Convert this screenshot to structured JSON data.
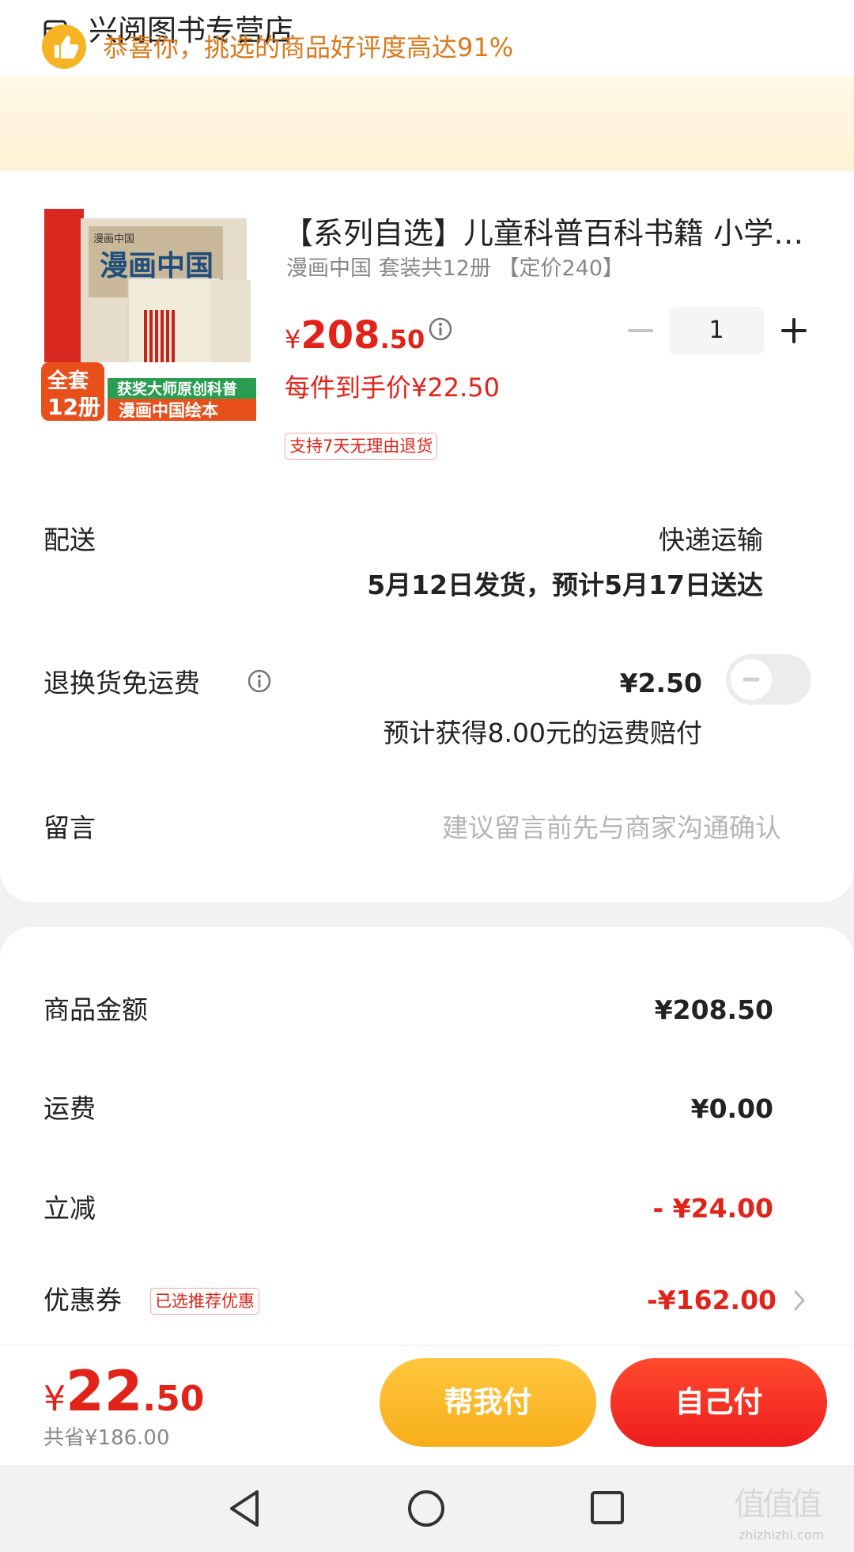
{
  "store": {
    "name": "兴阅图书专营店",
    "icon": "store-icon"
  },
  "banner": {
    "icon": "thumbs-up-icon",
    "text": "恭喜你，挑选的商品好评度高达91%",
    "color": "#d9791b"
  },
  "product": {
    "thumbnail": {
      "brand_top": "漫画中国",
      "big_title": "漫画中国",
      "set_label": "全套12册",
      "set_line1": "全套",
      "set_line2": "12册",
      "ribbon_line1": "获奖大师原创科普",
      "ribbon_line2": "漫画中国绘本"
    },
    "title": "【系列自选】儿童科普百科书籍 小学生漫画中国",
    "subtitle": "漫画中国 套装共12册 【定价240】",
    "price_currency": "¥",
    "price_int": "208",
    "price_dec": ".50",
    "price_info_icon": "info-icon",
    "quantity": "1",
    "unit_price_text": "每件到手价¥22.50",
    "return_badge": "支持7天无理由退货"
  },
  "delivery": {
    "label": "配送",
    "mode": "快递运输",
    "schedule": "5月12日发货，预计5月17日送达"
  },
  "freight_insurance": {
    "label": "退换货免运费",
    "info_icon": "info-icon",
    "price": "¥2.50",
    "enabled": false,
    "compensation": "预计获得8.00元的运费赔付"
  },
  "note": {
    "label": "留言",
    "placeholder": "建议留言前先与商家沟通确认"
  },
  "summary": {
    "items_label": "商品金额",
    "items_value": "¥208.50",
    "shipping_label": "运费",
    "shipping_value": "¥0.00",
    "discount_label": "立减",
    "discount_value": "- ¥24.00",
    "coupon_label": "优惠券",
    "coupon_badge": "已选推荐优惠",
    "coupon_value": "-¥162.00"
  },
  "paybar": {
    "total_currency": "¥",
    "total_int": "22",
    "total_dec": ".50",
    "saved_text": "共省¥186.00",
    "help_pay_label": "帮我付",
    "self_pay_label": "自己付"
  },
  "watermark": {
    "text": "值值值",
    "url": "zhizhizhi.com"
  },
  "colors": {
    "accent_red": "#e2231a",
    "accent_yellow": "#f8ae1b",
    "banner_text": "#d9791b"
  }
}
